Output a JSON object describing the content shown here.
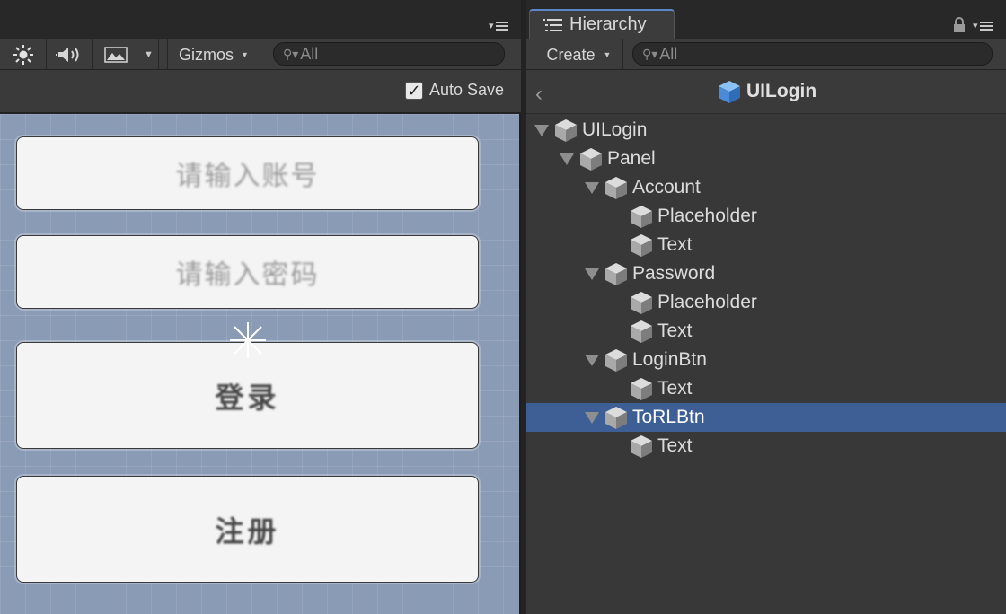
{
  "scene": {
    "toolbar": {
      "lighting_icon": "sun-icon",
      "audio_icon": "speaker-icon",
      "effects_icon": "landscape-image-icon",
      "gizmos_label": "Gizmos",
      "search_placeholder": "All"
    },
    "autosave": {
      "label": "Auto Save",
      "checked": true
    },
    "ui_elements": [
      {
        "kind": "input",
        "text": "请输入账号"
      },
      {
        "kind": "input",
        "text": "请输入密码"
      },
      {
        "kind": "button",
        "text": "登录"
      },
      {
        "kind": "button",
        "text": "注册"
      }
    ]
  },
  "hierarchy": {
    "tab_label": "Hierarchy",
    "create_label": "Create",
    "search_placeholder": "All",
    "prefab_title": "UILogin",
    "rows": [
      {
        "label": "UILogin",
        "depth": 0,
        "foldout": true,
        "selected": false
      },
      {
        "label": "Panel",
        "depth": 1,
        "foldout": true,
        "selected": false
      },
      {
        "label": "Account",
        "depth": 2,
        "foldout": true,
        "selected": false
      },
      {
        "label": "Placeholder",
        "depth": 3,
        "foldout": false,
        "selected": false
      },
      {
        "label": "Text",
        "depth": 3,
        "foldout": false,
        "selected": false
      },
      {
        "label": "Password",
        "depth": 2,
        "foldout": true,
        "selected": false
      },
      {
        "label": "Placeholder",
        "depth": 3,
        "foldout": false,
        "selected": false
      },
      {
        "label": "Text",
        "depth": 3,
        "foldout": false,
        "selected": false
      },
      {
        "label": "LoginBtn",
        "depth": 2,
        "foldout": true,
        "selected": false
      },
      {
        "label": "Text",
        "depth": 3,
        "foldout": false,
        "selected": false
      },
      {
        "label": "ToRLBtn",
        "depth": 2,
        "foldout": true,
        "selected": true
      },
      {
        "label": "Text",
        "depth": 3,
        "foldout": false,
        "selected": false
      }
    ]
  },
  "colors": {
    "selection": "#3e5f96",
    "viewport_bg": "#8a9bb6",
    "panel_bg": "#383838",
    "tab_accent": "#5d87c6",
    "prefab_cube": "#5b9be0"
  }
}
